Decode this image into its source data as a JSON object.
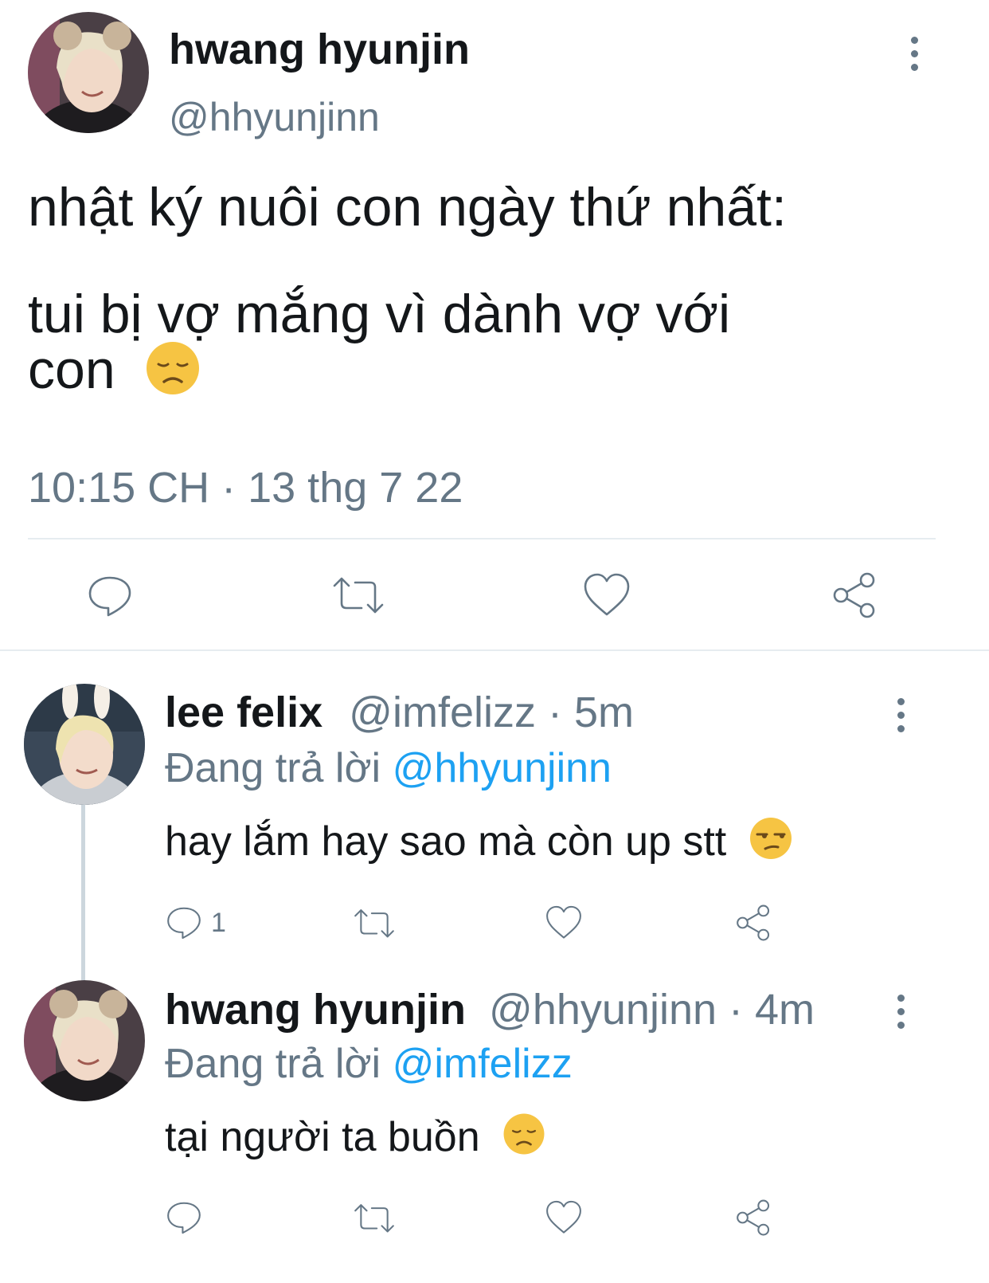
{
  "main_tweet": {
    "author_name": "hwang hyunjin",
    "handle": "@hhyunjinn",
    "text_line1": "nhật ký nuôi con ngày thứ nhất:",
    "text_line2": "tui bị vợ mắng vì dành vợ với",
    "text_line3": "con",
    "emoji": "disappointed-face",
    "timestamp": "10:15 CH · 13 thg 7 22",
    "actions": [
      "reply-icon",
      "retweet-icon",
      "like-icon",
      "share-icon"
    ]
  },
  "replies": [
    {
      "author_name": "lee felix",
      "handle": "@imfelizz",
      "time": "· 5m",
      "replying_prefix": "Đang trả lời",
      "replying_to": "@hhyunjinn",
      "text": "hay lắm hay sao mà còn up stt",
      "emoji": "unamused-face",
      "reply_count": "1"
    },
    {
      "author_name": "hwang hyunjin",
      "handle": "@hhyunjinn",
      "time": "· 4m",
      "replying_prefix": "Đang trả lời",
      "replying_to": "@imfelizz",
      "text": "tại người ta buồn",
      "emoji": "disappointed-face",
      "reply_count": ""
    }
  ],
  "colors": {
    "text": "#14171a",
    "secondary": "#657786",
    "link": "#1da1f2",
    "divider": "#e6ecf0",
    "thread_line": "#ccd6dd"
  }
}
